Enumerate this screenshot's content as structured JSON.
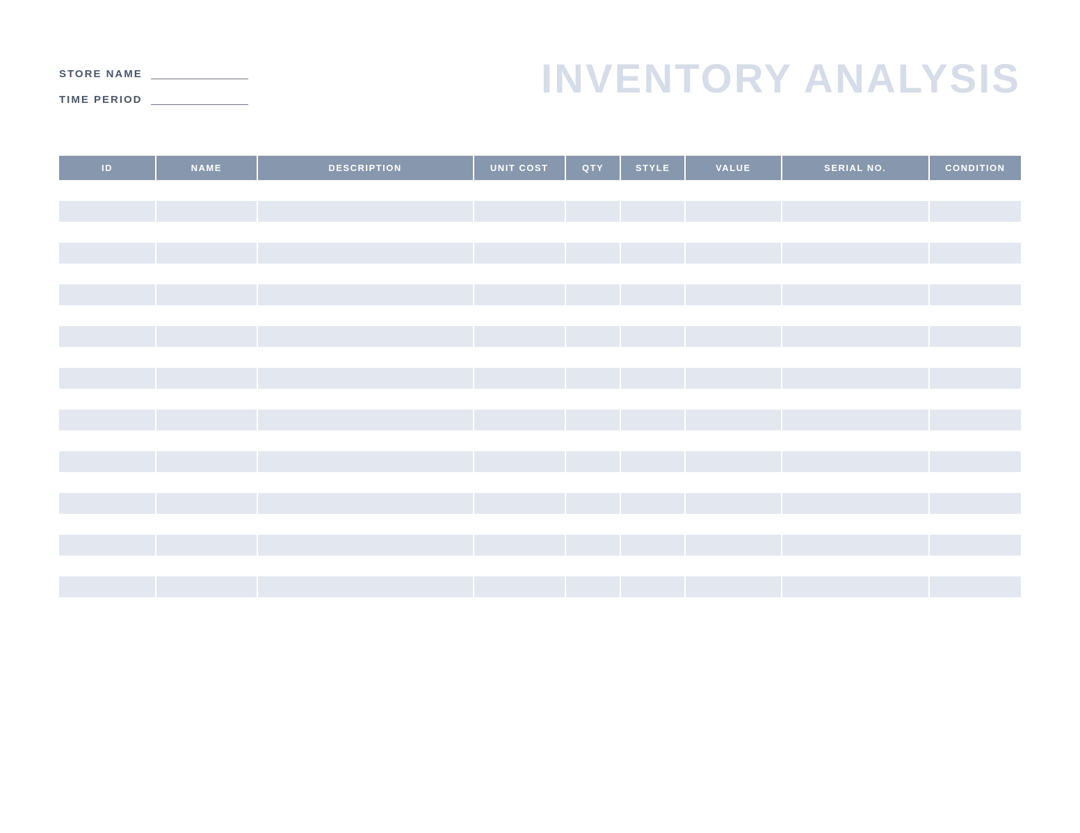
{
  "header": {
    "title": "INVENTORY ANALYSIS",
    "fields": {
      "store_name_label": "STORE NAME",
      "store_name_value": "",
      "time_period_label": "TIME PERIOD",
      "time_period_value": ""
    }
  },
  "table": {
    "columns": [
      "ID",
      "NAME",
      "DESCRIPTION",
      "UNIT COST",
      "QTY",
      "STYLE",
      "VALUE",
      "SERIAL NO.",
      "CONDITION"
    ],
    "rows": [
      [
        "",
        "",
        "",
        "",
        "",
        "",
        "",
        "",
        ""
      ],
      [
        "",
        "",
        "",
        "",
        "",
        "",
        "",
        "",
        ""
      ],
      [
        "",
        "",
        "",
        "",
        "",
        "",
        "",
        "",
        ""
      ],
      [
        "",
        "",
        "",
        "",
        "",
        "",
        "",
        "",
        ""
      ],
      [
        "",
        "",
        "",
        "",
        "",
        "",
        "",
        "",
        ""
      ],
      [
        "",
        "",
        "",
        "",
        "",
        "",
        "",
        "",
        ""
      ],
      [
        "",
        "",
        "",
        "",
        "",
        "",
        "",
        "",
        ""
      ],
      [
        "",
        "",
        "",
        "",
        "",
        "",
        "",
        "",
        ""
      ],
      [
        "",
        "",
        "",
        "",
        "",
        "",
        "",
        "",
        ""
      ],
      [
        "",
        "",
        "",
        "",
        "",
        "",
        "",
        "",
        ""
      ],
      [
        "",
        "",
        "",
        "",
        "",
        "",
        "",
        "",
        ""
      ],
      [
        "",
        "",
        "",
        "",
        "",
        "",
        "",
        "",
        ""
      ],
      [
        "",
        "",
        "",
        "",
        "",
        "",
        "",
        "",
        ""
      ],
      [
        "",
        "",
        "",
        "",
        "",
        "",
        "",
        "",
        ""
      ],
      [
        "",
        "",
        "",
        "",
        "",
        "",
        "",
        "",
        ""
      ],
      [
        "",
        "",
        "",
        "",
        "",
        "",
        "",
        "",
        ""
      ],
      [
        "",
        "",
        "",
        "",
        "",
        "",
        "",
        "",
        ""
      ],
      [
        "",
        "",
        "",
        "",
        "",
        "",
        "",
        "",
        ""
      ],
      [
        "",
        "",
        "",
        "",
        "",
        "",
        "",
        "",
        ""
      ],
      [
        "",
        "",
        "",
        "",
        "",
        "",
        "",
        "",
        ""
      ],
      [
        "",
        "",
        "",
        "",
        "",
        "",
        "",
        "",
        ""
      ]
    ]
  },
  "colors": {
    "header_bg": "#8797ad",
    "row_alt_bg": "#e3e7ef",
    "title_color": "#d6dce8",
    "label_color": "#4a5568"
  }
}
